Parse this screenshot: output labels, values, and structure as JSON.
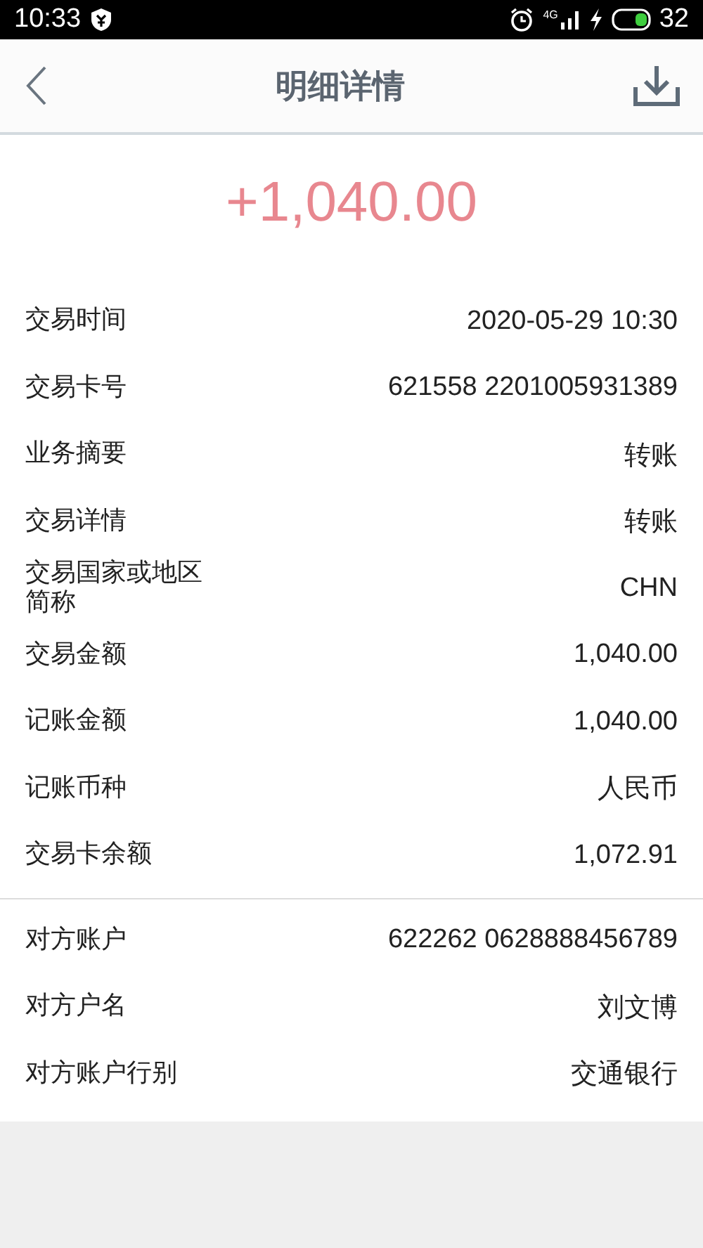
{
  "status_bar": {
    "time": "10:33",
    "network": "4G",
    "battery": "32"
  },
  "header": {
    "title": "明细详情"
  },
  "amount": "+1,040.00",
  "sections": [
    {
      "rows": [
        {
          "label": "交易时间",
          "value": "2020-05-29 10:30"
        },
        {
          "label": "交易卡号",
          "value": "621558 2201005931389"
        },
        {
          "label": "业务摘要",
          "value": "转账"
        },
        {
          "label": "交易详情",
          "value": "转账"
        },
        {
          "label": "交易国家或地区简称",
          "value": "CHN"
        },
        {
          "label": "交易金额",
          "value": "1,040.00"
        },
        {
          "label": "记账金额",
          "value": "1,040.00"
        },
        {
          "label": "记账币种",
          "value": "人民币"
        },
        {
          "label": "交易卡余额",
          "value": "1,072.91"
        }
      ]
    },
    {
      "rows": [
        {
          "label": "对方账户",
          "value": "622262 0628888456789"
        },
        {
          "label": "对方户名",
          "value": "刘文博"
        },
        {
          "label": "对方账户行别",
          "value": "交通银行"
        }
      ]
    }
  ]
}
